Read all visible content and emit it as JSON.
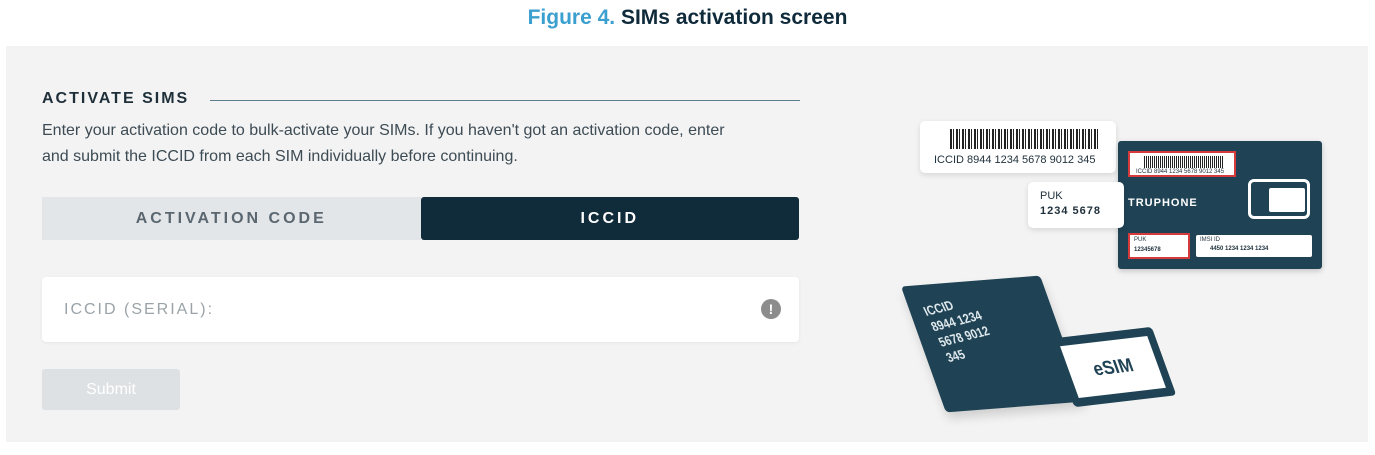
{
  "figure": {
    "number_label": "Figure 4.",
    "title": "SIMs activation screen"
  },
  "activate": {
    "heading": "ACTIVATE SIMS",
    "intro_line1": "Enter your activation code to bulk-activate your SIMs. If you haven't got an activation code, enter",
    "intro_line2": "and submit the ICCID from each SIM individually before continuing.",
    "tabs": [
      {
        "label": "ACTIVATION CODE",
        "active": false
      },
      {
        "label": "ICCID",
        "active": true
      }
    ],
    "iccid_field": {
      "placeholder": "ICCID (SERIAL):",
      "value": "",
      "icon": "alert-circle-icon"
    },
    "submit_label": "Submit"
  },
  "illustration": {
    "barcode_text": "ICCID 8944 1234 5678 9012 345",
    "puk_label": "PUK",
    "puk_value": "1234 5678",
    "card_iccid_small": "ICCID 8944 1234 5678 9012 345",
    "card_brand": "TRUPHONE",
    "card_puk_small": "PUK",
    "card_puk_value_small": "12345678",
    "card_imsi_label": "IMSI ID",
    "card_imsi_value": "4450 1234 1234 1234",
    "chip_text": "ICCID\n8944 1234\n5678 9012\n345",
    "esim_label": "eSIM"
  },
  "colors": {
    "caption_number": "#3ba0cf",
    "caption_title": "#0f2a3a",
    "panel_bg": "#f3f3f3",
    "tab_active_bg": "#102b3a",
    "tab_inactive_bg": "#e3e6e8",
    "submit_disabled_bg": "#dde1e4",
    "sim_card_bg": "#1f4354"
  }
}
